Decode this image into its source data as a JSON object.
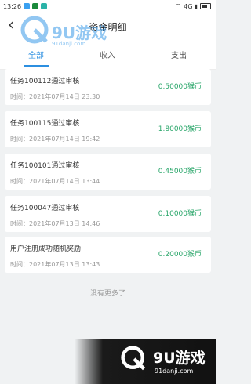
{
  "status_bar": {
    "time": "13:26",
    "network": "4G",
    "colors": {
      "icon1": "#3aa0f0",
      "icon2": "#1b8a3c",
      "icon3": "#2bb3a8"
    }
  },
  "header": {
    "back_icon": "chevron-left-icon",
    "title": "资金明细"
  },
  "tabs": [
    {
      "label": "全部",
      "active": true
    },
    {
      "label": "收入",
      "active": false
    },
    {
      "label": "支出",
      "active": false
    }
  ],
  "records": [
    {
      "task": "任务100112通过审核",
      "time": "时间：2021年07月14日 23:30",
      "amount": "0.50000猴币"
    },
    {
      "task": "任务100115通过审核",
      "time": "时间：2021年07月14日 19:42",
      "amount": "1.80000猴币"
    },
    {
      "task": "任务100101通过审核",
      "time": "时间：2021年07月14日 13:44",
      "amount": "0.45000猴币"
    },
    {
      "task": "任务100047通过审核",
      "time": "时间：2021年07月13日 14:46",
      "amount": "0.10000猴币"
    },
    {
      "task": "用户注册成功随机奖励",
      "time": "时间：2021年07月13日 13:43",
      "amount": "0.20000猴币"
    }
  ],
  "footer_text": "没有更多了",
  "watermark": {
    "brand": "9U游戏",
    "url": "91danji.com"
  },
  "accent_colors": {
    "tab_active": "#2c8fe0",
    "amount": "#2aa66a"
  }
}
